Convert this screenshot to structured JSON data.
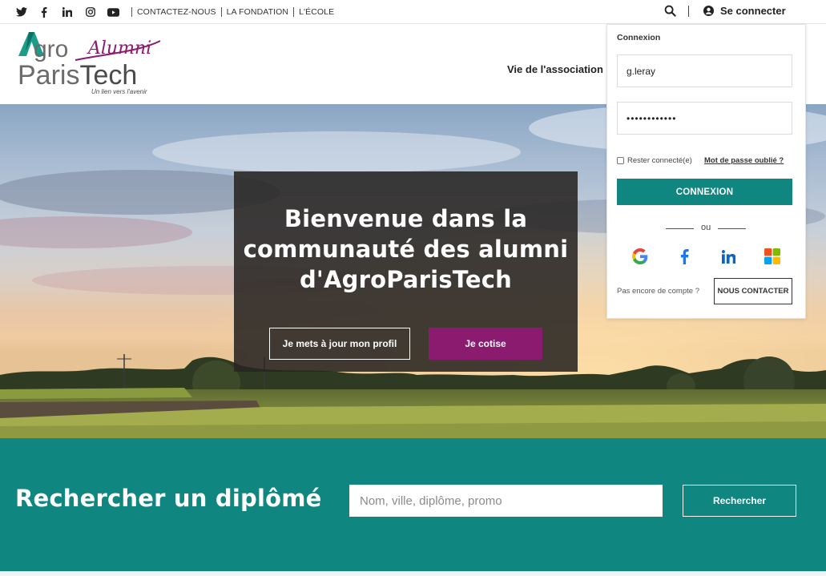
{
  "topbar": {
    "social": [
      "twitter-icon",
      "facebook-icon",
      "linkedin-icon",
      "instagram-icon",
      "youtube-icon"
    ],
    "links": [
      "CONTACTEZ-NOUS",
      "LA FONDATION",
      "L'ÉCOLE"
    ],
    "login_label": "Se connecter"
  },
  "header": {
    "logo": {
      "line1": "Agro",
      "word_alumni": "Alumni",
      "line2": "ParisTech",
      "tagline": "Un lien vers l'avenir"
    },
    "nav": [
      "Vie de l'association"
    ]
  },
  "hero": {
    "title": "Bienvenue dans la communauté des alumni d'AgroParisTech",
    "btn_profile": "Je mets à jour mon profil",
    "btn_cotise": "Je cotise"
  },
  "search": {
    "title": "Rechercher un diplômé",
    "placeholder": "Nom, ville, diplôme, promo",
    "button": "Rechercher"
  },
  "login_panel": {
    "title": "Connexion",
    "username": "g.leray",
    "password": "••••••••••••",
    "remember": "Rester connecté(e)",
    "forgot": "Mot de passe oublié ?",
    "submit": "CONNEXION",
    "or": "ou",
    "providers": [
      "google-icon",
      "facebook-icon",
      "linkedin-icon",
      "microsoft-icon"
    ],
    "no_account": "Pas encore de compte ?",
    "contact": "NOUS CONTACTER"
  },
  "colors": {
    "teal": "#0f8680",
    "plum": "#8b1b6e",
    "logo_green": "#1a9e8a",
    "logo_gray": "#6b6b6b"
  }
}
